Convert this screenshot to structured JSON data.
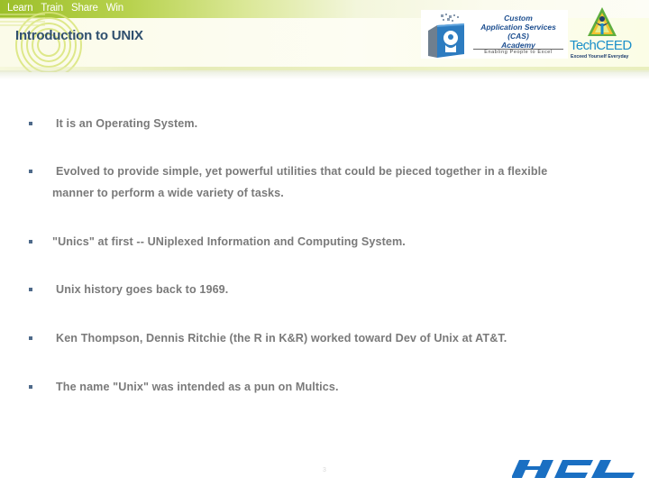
{
  "header": {
    "tagline": [
      "Learn",
      "Train",
      "Share",
      "Win"
    ],
    "title": "Introduction to UNIX",
    "colors": {
      "tagline_bar": "#9cbf2a",
      "title": "#2f4f6e"
    }
  },
  "logos": {
    "cas": {
      "lines": [
        "Custom",
        "Application Services",
        "(CAS)",
        "Academy"
      ],
      "subtitle": "Enabling People to Excel",
      "icon": "book-head-icon"
    },
    "techceed": {
      "name_part1": "Tech",
      "name_part2": "CEED",
      "slogan": "Exceed Yourself Everyday",
      "icon": "person-triangle-icon"
    },
    "hcl": {
      "name": "HCL",
      "color": "#1a6fc2"
    }
  },
  "bullets": [
    {
      "text": "It is an Operating System."
    },
    {
      "text": "Evolved  to provide simple, yet powerful utilities that could be pieced together in a flexible",
      "continuation": "manner to perform a wide variety of tasks."
    },
    {
      "text": "\"Unics\" at first -- UNiplexed Information and Computing System."
    },
    {
      "text": "Unix history goes back to 1969."
    },
    {
      "text": "Ken Thompson, Dennis Ritchie (the R in K&R) worked toward Dev of Unix at AT&T."
    },
    {
      "text": "The name \"Unix\" was intended as a pun on Multics."
    }
  ],
  "footer": {
    "slide_number": "3"
  }
}
